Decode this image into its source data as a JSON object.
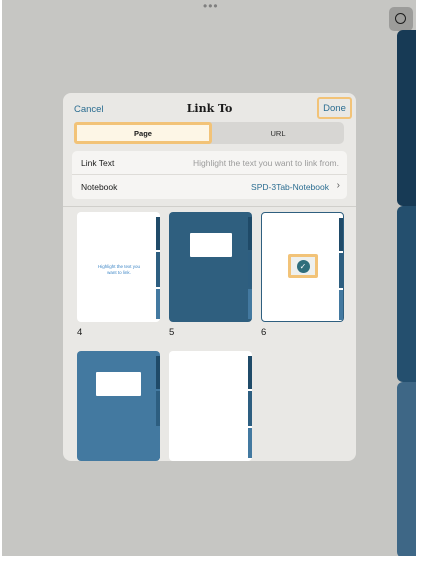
{
  "header": {
    "cancel_label": "Cancel",
    "title": "Link To",
    "done_label": "Done"
  },
  "segmented": {
    "page_label": "Page",
    "url_label": "URL",
    "selected": "Page"
  },
  "fields": {
    "link_text_label": "Link Text",
    "link_text_placeholder": "Highlight the text you want to link from.",
    "notebook_label": "Notebook",
    "notebook_value": "SPD-3Tab-Notebook"
  },
  "pages": [
    {
      "number": "4",
      "style": "white",
      "content_text": "Highlight the text you want to link."
    },
    {
      "number": "5",
      "style": "dark"
    },
    {
      "number": "6",
      "style": "selected",
      "checked": true
    },
    {
      "number": "",
      "style": "medium"
    },
    {
      "number": "",
      "style": "white"
    }
  ],
  "colors": {
    "accent_blue": "#2b6d91",
    "highlight": "#f2c378",
    "tab_dark": "#173a55",
    "tab_mid": "#244f6e",
    "tab_light": "#3e6786"
  },
  "icons": {
    "grabber": "more-dots-icon",
    "side_button": "circle-icon",
    "notebook_chevron": "chevron-right-icon",
    "selected_mark": "checkmark-circle-icon"
  }
}
